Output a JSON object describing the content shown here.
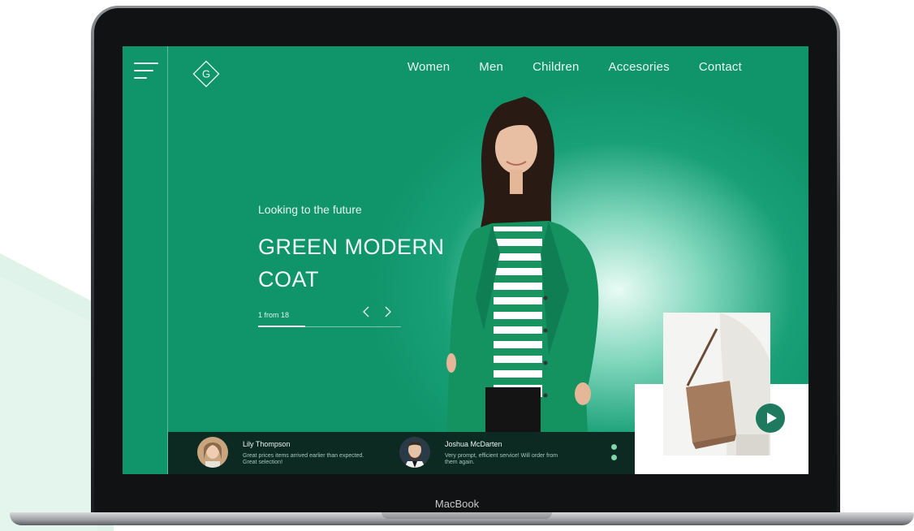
{
  "device": {
    "label": "MacBook"
  },
  "nav": {
    "items": [
      "Women",
      "Men",
      "Children",
      "Accesories",
      "Contact"
    ]
  },
  "logo": {
    "letter": "G"
  },
  "hero": {
    "subtitle": "Looking to the future",
    "title": "GREEN MODERN COAT",
    "pager": "1 from 18",
    "progress": 0.33
  },
  "reviews": [
    {
      "name": "Lily Thompson",
      "text": "Great prices items arrived earlier than expected. Great selection!"
    },
    {
      "name": "Joshua McDarten",
      "text": "Very prompt, efficient service! Will order from them again."
    }
  ],
  "icons": {
    "menu": "hamburger-menu-icon",
    "logo": "diamond-logo-icon",
    "prev": "chevron-left-icon",
    "next": "chevron-right-icon",
    "play": "play-icon"
  },
  "colors": {
    "accent": "#10946a",
    "dark": "#0c2a22",
    "play": "#1d7a5e"
  }
}
